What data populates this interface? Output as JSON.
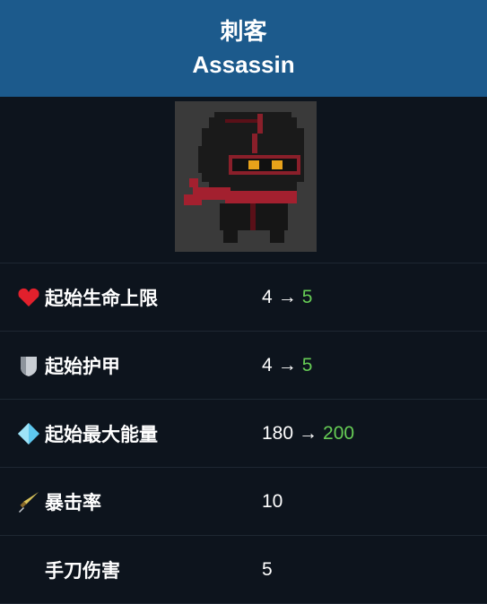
{
  "header": {
    "title_cn": "刺客",
    "title_en": "Assassin"
  },
  "portrait": {
    "icon": "assassin-ninja-sprite"
  },
  "stats": [
    {
      "label": "起始生命上限",
      "icon": "heart-icon",
      "old": "4",
      "arrow": "→",
      "new": "5"
    },
    {
      "label": "起始护甲",
      "icon": "shield-icon",
      "old": "4",
      "arrow": "→",
      "new": "5"
    },
    {
      "label": "起始最大能量",
      "icon": "energy-crystal-icon",
      "old": "180",
      "arrow": "→",
      "new": "200"
    },
    {
      "label": "暴击率",
      "icon": "crit-blade-icon",
      "value": "10"
    },
    {
      "label": "手刀伤害",
      "value": "5"
    }
  ],
  "colors": {
    "header_bg": "#1c5a8c",
    "body_bg": "#0d141d",
    "new_value": "#66cc55"
  }
}
